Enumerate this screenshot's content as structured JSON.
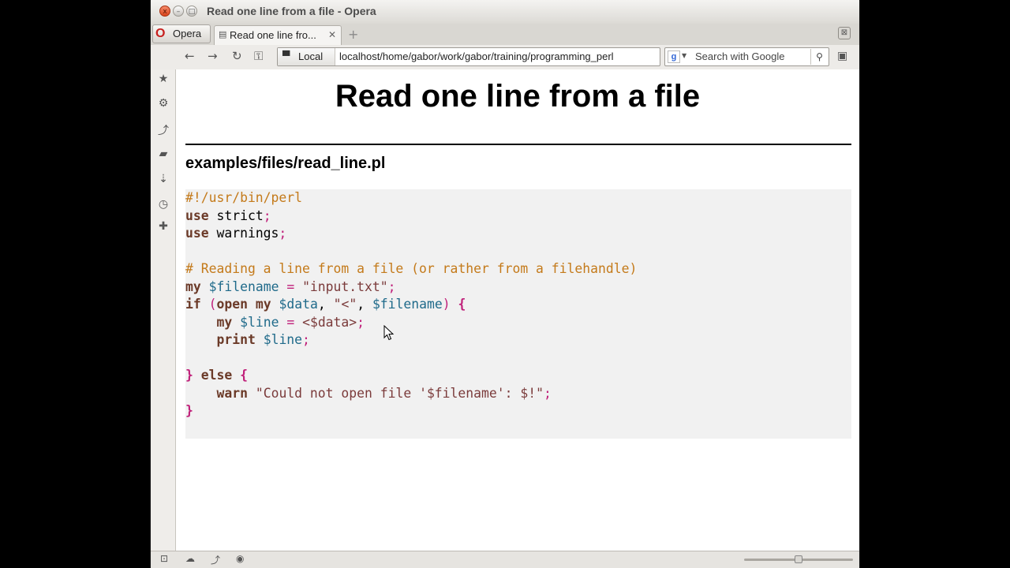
{
  "window": {
    "title": "Read one line from a file - Opera",
    "close_glyph": "x",
    "minimize_glyph": "–",
    "maximize_glyph": "□"
  },
  "tabs": {
    "menu_label": "Opera",
    "menu_logo": "O",
    "active_tab_label": "Read one line fro...",
    "tab_close_glyph": "✕",
    "new_tab_glyph": "+",
    "trash_glyph": "⊠"
  },
  "navbar": {
    "back_glyph": "←",
    "forward_glyph": "→",
    "reload_glyph": "↻",
    "key_glyph": "⚿",
    "local_label": "Local",
    "local_icon": "▀",
    "url": "localhost/home/gabor/work/gabor/training/programming_perl",
    "search_placeholder": "Search with Google",
    "search_engine_icon": "g",
    "search_button_glyph": "⚲",
    "menu_glyph": "▣"
  },
  "sidebar": {
    "icons": [
      "★",
      "⚙",
      "⤴",
      "▰",
      "⇣",
      "◷",
      "✚"
    ]
  },
  "page": {
    "title": "Read one line from a file",
    "file_heading": "examples/files/read_line.pl"
  },
  "code_lines": [
    [
      {
        "t": "#!/usr/bin/perl",
        "c": "comment"
      }
    ],
    [
      {
        "t": "use",
        "c": "keyword"
      },
      {
        "t": " strict",
        "c": "plain"
      },
      {
        "t": ";",
        "c": "punct"
      }
    ],
    [
      {
        "t": "use",
        "c": "keyword"
      },
      {
        "t": " warnings",
        "c": "plain"
      },
      {
        "t": ";",
        "c": "punct"
      }
    ],
    [],
    [
      {
        "t": "# Reading a line from a file (or rather from a filehandle)",
        "c": "comment"
      }
    ],
    [
      {
        "t": "my",
        "c": "keyword"
      },
      {
        "t": " ",
        "c": "plain"
      },
      {
        "t": "$filename",
        "c": "var"
      },
      {
        "t": " ",
        "c": "plain"
      },
      {
        "t": "=",
        "c": "punct"
      },
      {
        "t": " ",
        "c": "plain"
      },
      {
        "t": "\"input.txt\"",
        "c": "string"
      },
      {
        "t": ";",
        "c": "punct"
      }
    ],
    [
      {
        "t": "if",
        "c": "keyword"
      },
      {
        "t": " ",
        "c": "plain"
      },
      {
        "t": "(",
        "c": "punct"
      },
      {
        "t": "open",
        "c": "keyword"
      },
      {
        "t": " ",
        "c": "plain"
      },
      {
        "t": "my",
        "c": "keyword"
      },
      {
        "t": " ",
        "c": "plain"
      },
      {
        "t": "$data",
        "c": "var"
      },
      {
        "t": ", ",
        "c": "plain"
      },
      {
        "t": "\"<\"",
        "c": "string"
      },
      {
        "t": ", ",
        "c": "plain"
      },
      {
        "t": "$filename",
        "c": "var"
      },
      {
        "t": ")",
        "c": "punct"
      },
      {
        "t": " ",
        "c": "plain"
      },
      {
        "t": "{",
        "c": "brace"
      }
    ],
    [
      {
        "t": "    ",
        "c": "plain"
      },
      {
        "t": "my",
        "c": "keyword"
      },
      {
        "t": " ",
        "c": "plain"
      },
      {
        "t": "$line",
        "c": "var"
      },
      {
        "t": " ",
        "c": "plain"
      },
      {
        "t": "=",
        "c": "punct"
      },
      {
        "t": " ",
        "c": "plain"
      },
      {
        "t": "<$data>",
        "c": "string"
      },
      {
        "t": ";",
        "c": "punct"
      }
    ],
    [
      {
        "t": "    ",
        "c": "plain"
      },
      {
        "t": "print",
        "c": "keyword"
      },
      {
        "t": " ",
        "c": "plain"
      },
      {
        "t": "$line",
        "c": "var"
      },
      {
        "t": ";",
        "c": "punct"
      }
    ],
    [],
    [
      {
        "t": "}",
        "c": "brace"
      },
      {
        "t": " ",
        "c": "plain"
      },
      {
        "t": "else",
        "c": "keyword"
      },
      {
        "t": " ",
        "c": "plain"
      },
      {
        "t": "{",
        "c": "brace"
      }
    ],
    [
      {
        "t": "    ",
        "c": "plain"
      },
      {
        "t": "warn",
        "c": "keyword"
      },
      {
        "t": " ",
        "c": "plain"
      },
      {
        "t": "\"Could not open file '$filename': $!\"",
        "c": "string"
      },
      {
        "t": ";",
        "c": "punct"
      }
    ],
    [
      {
        "t": "}",
        "c": "brace"
      }
    ]
  ],
  "statusbar": {
    "icons": [
      "⊡",
      "☁",
      "⤴",
      "◉"
    ],
    "zoom_fraction": 0.5
  },
  "colors": {
    "comment": "#c47a1a",
    "keyword": "#6b3a28",
    "punct": "#c0207a",
    "variable": "#1f6a8a",
    "string": "#7b3b3b",
    "code_background": "#f1f1f1"
  }
}
